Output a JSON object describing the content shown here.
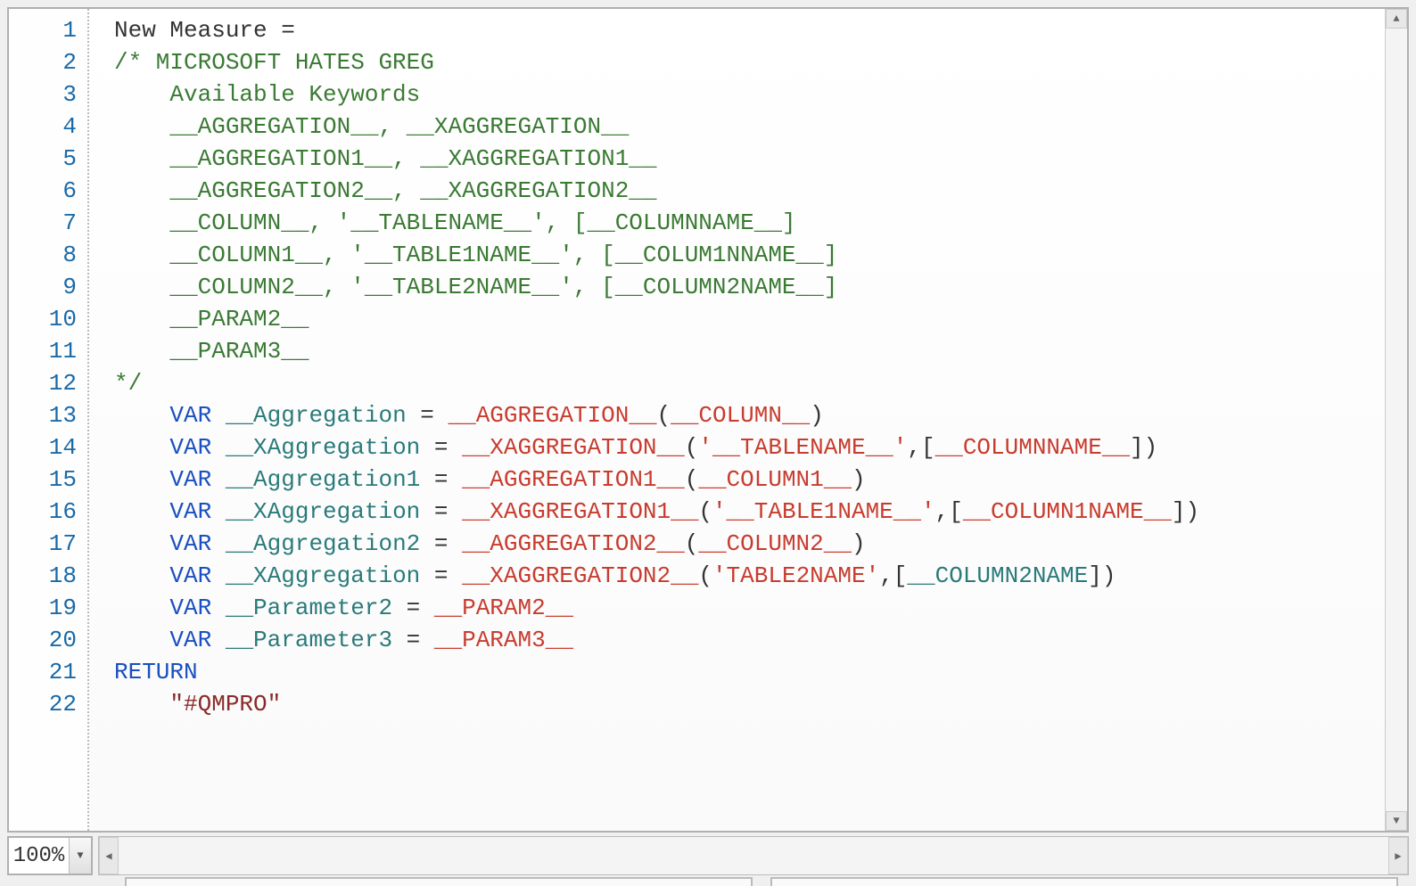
{
  "zoom": "100%",
  "lines": [
    {
      "n": 1,
      "tokens": [
        [
          "plain",
          "New Measure ="
        ]
      ]
    },
    {
      "n": 2,
      "tokens": [
        [
          "comment",
          "/* MICROSOFT HATES GREG"
        ]
      ]
    },
    {
      "n": 3,
      "tokens": [
        [
          "comment",
          "    Available Keywords"
        ]
      ]
    },
    {
      "n": 4,
      "tokens": [
        [
          "comment",
          "    __AGGREGATION__, __XAGGREGATION__"
        ]
      ]
    },
    {
      "n": 5,
      "tokens": [
        [
          "comment",
          "    __AGGREGATION1__, __XAGGREGATION1__"
        ]
      ]
    },
    {
      "n": 6,
      "tokens": [
        [
          "comment",
          "    __AGGREGATION2__, __XAGGREGATION2__"
        ]
      ]
    },
    {
      "n": 7,
      "tokens": [
        [
          "comment",
          "    __COLUMN__, '__TABLENAME__', [__COLUMNNAME__]"
        ]
      ]
    },
    {
      "n": 8,
      "tokens": [
        [
          "comment",
          "    __COLUMN1__, '__TABLE1NAME__', [__COLUM1NNAME__]"
        ]
      ]
    },
    {
      "n": 9,
      "tokens": [
        [
          "comment",
          "    __COLUMN2__, '__TABLE2NAME__', [__COLUMN2NAME__]"
        ]
      ]
    },
    {
      "n": 10,
      "tokens": [
        [
          "comment",
          "    __PARAM2__"
        ]
      ]
    },
    {
      "n": 11,
      "tokens": [
        [
          "comment",
          "    __PARAM3__"
        ]
      ]
    },
    {
      "n": 12,
      "tokens": [
        [
          "comment",
          "*/"
        ]
      ]
    },
    {
      "n": 13,
      "tokens": [
        [
          "plain",
          "    "
        ],
        [
          "keyword",
          "VAR"
        ],
        [
          "plain",
          " "
        ],
        [
          "var",
          "__Aggregation"
        ],
        [
          "plain",
          " = "
        ],
        [
          "func",
          "__AGGREGATION__"
        ],
        [
          "paren",
          "("
        ],
        [
          "func",
          "__COLUMN__"
        ],
        [
          "paren",
          ")"
        ]
      ]
    },
    {
      "n": 14,
      "tokens": [
        [
          "plain",
          "    "
        ],
        [
          "keyword",
          "VAR"
        ],
        [
          "plain",
          " "
        ],
        [
          "var",
          "__XAggregation"
        ],
        [
          "plain",
          " = "
        ],
        [
          "func",
          "__XAGGREGATION__"
        ],
        [
          "paren",
          "("
        ],
        [
          "func",
          "'__TABLENAME__'"
        ],
        [
          "plain",
          ",["
        ],
        [
          "func",
          "__COLUMNNAME__"
        ],
        [
          "plain",
          "])"
        ]
      ]
    },
    {
      "n": 15,
      "tokens": [
        [
          "plain",
          "    "
        ],
        [
          "keyword",
          "VAR"
        ],
        [
          "plain",
          " "
        ],
        [
          "var",
          "__Aggregation1"
        ],
        [
          "plain",
          " = "
        ],
        [
          "func",
          "__AGGREGATION1__"
        ],
        [
          "paren",
          "("
        ],
        [
          "func",
          "__COLUMN1__"
        ],
        [
          "paren",
          ")"
        ]
      ]
    },
    {
      "n": 16,
      "tokens": [
        [
          "plain",
          "    "
        ],
        [
          "keyword",
          "VAR"
        ],
        [
          "plain",
          " "
        ],
        [
          "var",
          "__XAggregation"
        ],
        [
          "plain",
          " = "
        ],
        [
          "func",
          "__XAGGREGATION1__"
        ],
        [
          "paren",
          "("
        ],
        [
          "func",
          "'__TABLE1NAME__'"
        ],
        [
          "plain",
          ",["
        ],
        [
          "func",
          "__COLUMN1NAME__"
        ],
        [
          "plain",
          "])"
        ]
      ]
    },
    {
      "n": 17,
      "tokens": [
        [
          "plain",
          "    "
        ],
        [
          "keyword",
          "VAR"
        ],
        [
          "plain",
          " "
        ],
        [
          "var",
          "__Aggregation2"
        ],
        [
          "plain",
          " = "
        ],
        [
          "func",
          "__AGGREGATION2__"
        ],
        [
          "paren",
          "("
        ],
        [
          "func",
          "__COLUMN2__"
        ],
        [
          "paren",
          ")"
        ]
      ]
    },
    {
      "n": 18,
      "tokens": [
        [
          "plain",
          "    "
        ],
        [
          "keyword",
          "VAR"
        ],
        [
          "plain",
          " "
        ],
        [
          "var",
          "__XAggregation"
        ],
        [
          "plain",
          " = "
        ],
        [
          "func",
          "__XAGGREGATION2__"
        ],
        [
          "paren",
          "("
        ],
        [
          "func",
          "'TABLE2NAME'"
        ],
        [
          "plain",
          ",["
        ],
        [
          "col",
          "__COLUMN2NAME"
        ],
        [
          "plain",
          "])"
        ]
      ]
    },
    {
      "n": 19,
      "tokens": [
        [
          "plain",
          "    "
        ],
        [
          "keyword",
          "VAR"
        ],
        [
          "plain",
          " "
        ],
        [
          "var",
          "__Parameter2"
        ],
        [
          "plain",
          " = "
        ],
        [
          "func",
          "__PARAM2__"
        ]
      ]
    },
    {
      "n": 20,
      "tokens": [
        [
          "plain",
          "    "
        ],
        [
          "keyword",
          "VAR"
        ],
        [
          "plain",
          " "
        ],
        [
          "var",
          "__Parameter3"
        ],
        [
          "plain",
          " = "
        ],
        [
          "func",
          "__PARAM3__"
        ]
      ]
    },
    {
      "n": 21,
      "tokens": [
        [
          "keyword",
          "RETURN"
        ]
      ]
    },
    {
      "n": 22,
      "tokens": [
        [
          "plain",
          "    "
        ],
        [
          "str",
          "\"#QMPRO\""
        ]
      ]
    }
  ]
}
